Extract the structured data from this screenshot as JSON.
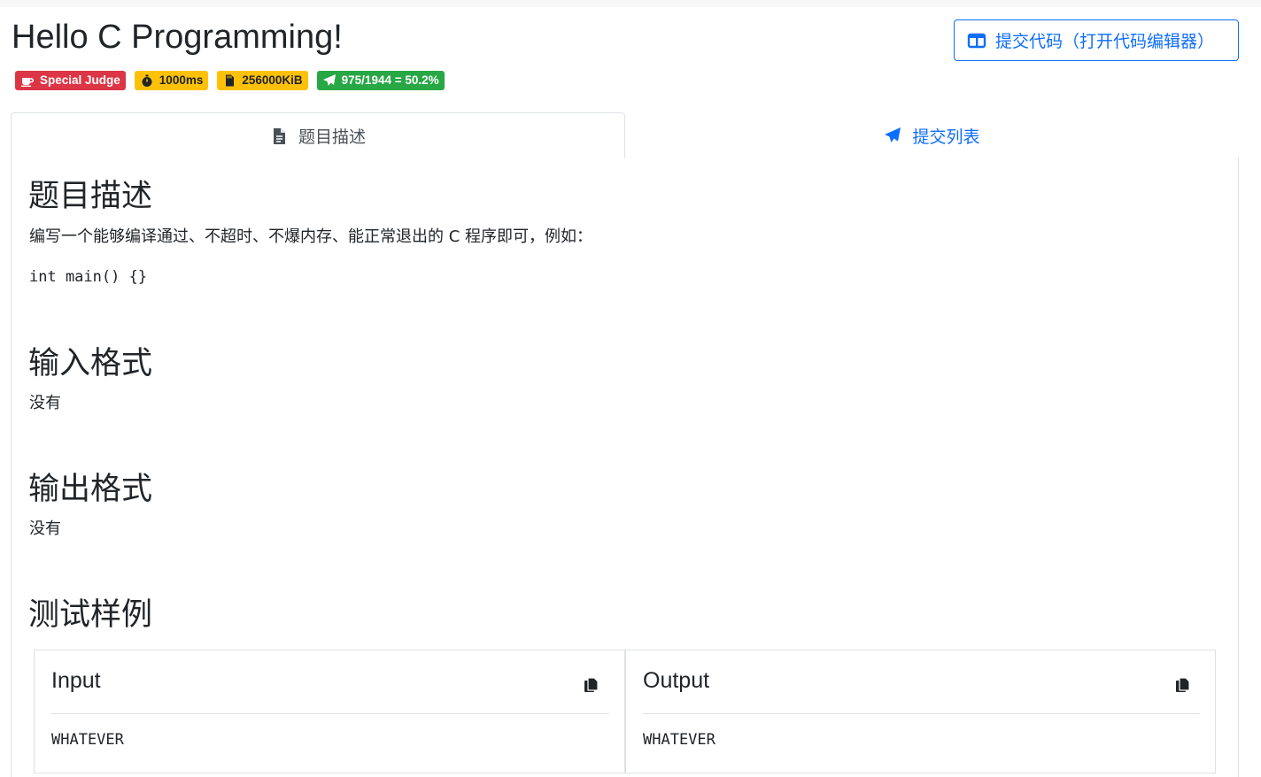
{
  "problem": {
    "title": "Hello C Programming!",
    "badges": [
      {
        "label": "Special Judge",
        "icon": "coffee-cup-icon",
        "color": "#dc3545"
      },
      {
        "label": "1000ms",
        "icon": "stopwatch-icon",
        "color": "#ffc107"
      },
      {
        "label": "256000KiB",
        "icon": "memory-card-icon",
        "color": "#ffc107"
      },
      {
        "label": "975/1944 = 50.2%",
        "icon": "paper-plane-icon",
        "color": "#28a745"
      }
    ]
  },
  "actions": {
    "submit_label": "提交代码（打开代码编辑器）",
    "submit_icon": "columns-icon"
  },
  "tabs": [
    {
      "label": "题目描述",
      "icon": "file-icon",
      "active": true
    },
    {
      "label": "提交列表",
      "icon": "paper-plane-icon",
      "active": false
    }
  ],
  "content": {
    "description_heading": "题目描述",
    "description_text": "编写一个能够编译通过、不超时、不爆内存、能正常退出的 C 程序即可，例如：",
    "code_example": "int main() {}",
    "input_heading": "输入格式",
    "input_text": "没有",
    "output_heading": "输出格式",
    "output_text": "没有",
    "samples_heading": "测试样例"
  },
  "samples": {
    "input_title": "Input",
    "input_value": "WHATEVER",
    "output_title": "Output",
    "output_value": "WHATEVER",
    "copy_icon": "copy-icon"
  },
  "colors": {
    "primary": "#0d6efd",
    "danger": "#dc3545",
    "warning": "#ffc107",
    "success": "#28a745"
  }
}
